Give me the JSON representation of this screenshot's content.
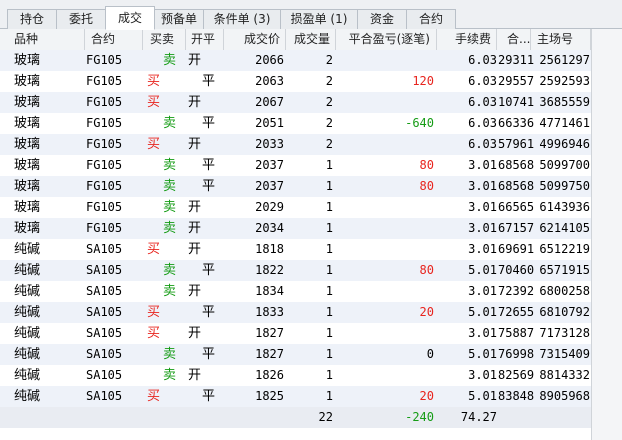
{
  "tabs": [
    {
      "label": "持仓",
      "active": false
    },
    {
      "label": "委托",
      "active": false
    },
    {
      "label": "成交",
      "active": true
    },
    {
      "label": "预备单",
      "active": false
    },
    {
      "label": "条件单 (3)",
      "active": false
    },
    {
      "label": "损盈单 (1)",
      "active": false
    },
    {
      "label": "资金",
      "active": false
    },
    {
      "label": "合约",
      "active": false
    }
  ],
  "columns": [
    "品种",
    "合约",
    "买卖",
    "开平",
    "成交价",
    "成交量",
    "平合盈亏(逐笔)",
    "手续费",
    "合...",
    "主场号"
  ],
  "rows": [
    {
      "product": "玻璃",
      "contract": "FG105",
      "side": "卖",
      "oc": "开",
      "price": "2066",
      "qty": "2",
      "pnl": "",
      "fee": "6.03",
      "trade": "29311",
      "id": "2561297"
    },
    {
      "product": "玻璃",
      "contract": "FG105",
      "side": "买",
      "oc": "平",
      "price": "2063",
      "qty": "2",
      "pnl": "120",
      "fee": "6.03",
      "trade": "29557",
      "id": "2592593"
    },
    {
      "product": "玻璃",
      "contract": "FG105",
      "side": "买",
      "oc": "开",
      "price": "2067",
      "qty": "2",
      "pnl": "",
      "fee": "6.03",
      "trade": "10741",
      "id": "3685559"
    },
    {
      "product": "玻璃",
      "contract": "FG105",
      "side": "卖",
      "oc": "平",
      "price": "2051",
      "qty": "2",
      "pnl": "-640",
      "fee": "6.03",
      "trade": "66336",
      "id": "4771461"
    },
    {
      "product": "玻璃",
      "contract": "FG105",
      "side": "买",
      "oc": "开",
      "price": "2033",
      "qty": "2",
      "pnl": "",
      "fee": "6.03",
      "trade": "57961",
      "id": "4996946"
    },
    {
      "product": "玻璃",
      "contract": "FG105",
      "side": "卖",
      "oc": "平",
      "price": "2037",
      "qty": "1",
      "pnl": "80",
      "fee": "3.01",
      "trade": "68568",
      "id": "5099700"
    },
    {
      "product": "玻璃",
      "contract": "FG105",
      "side": "卖",
      "oc": "平",
      "price": "2037",
      "qty": "1",
      "pnl": "80",
      "fee": "3.01",
      "trade": "68568",
      "id": "5099750"
    },
    {
      "product": "玻璃",
      "contract": "FG105",
      "side": "卖",
      "oc": "开",
      "price": "2029",
      "qty": "1",
      "pnl": "",
      "fee": "3.01",
      "trade": "66565",
      "id": "6143936"
    },
    {
      "product": "玻璃",
      "contract": "FG105",
      "side": "卖",
      "oc": "开",
      "price": "2034",
      "qty": "1",
      "pnl": "",
      "fee": "3.01",
      "trade": "67157",
      "id": "6214105"
    },
    {
      "product": "纯碱",
      "contract": "SA105",
      "side": "买",
      "oc": "开",
      "price": "1818",
      "qty": "1",
      "pnl": "",
      "fee": "3.01",
      "trade": "69691",
      "id": "6512219"
    },
    {
      "product": "纯碱",
      "contract": "SA105",
      "side": "卖",
      "oc": "平",
      "price": "1822",
      "qty": "1",
      "pnl": "80",
      "fee": "5.01",
      "trade": "70460",
      "id": "6571915"
    },
    {
      "product": "纯碱",
      "contract": "SA105",
      "side": "卖",
      "oc": "开",
      "price": "1834",
      "qty": "1",
      "pnl": "",
      "fee": "3.01",
      "trade": "72392",
      "id": "6800258"
    },
    {
      "product": "纯碱",
      "contract": "SA105",
      "side": "买",
      "oc": "平",
      "price": "1833",
      "qty": "1",
      "pnl": "20",
      "fee": "5.01",
      "trade": "72655",
      "id": "6810792"
    },
    {
      "product": "纯碱",
      "contract": "SA105",
      "side": "买",
      "oc": "开",
      "price": "1827",
      "qty": "1",
      "pnl": "",
      "fee": "3.01",
      "trade": "75887",
      "id": "7173128"
    },
    {
      "product": "纯碱",
      "contract": "SA105",
      "side": "卖",
      "oc": "平",
      "price": "1827",
      "qty": "1",
      "pnl": "0",
      "fee": "5.01",
      "trade": "76998",
      "id": "7315409"
    },
    {
      "product": "纯碱",
      "contract": "SA105",
      "side": "卖",
      "oc": "开",
      "price": "1826",
      "qty": "1",
      "pnl": "",
      "fee": "3.01",
      "trade": "82569",
      "id": "8814332"
    },
    {
      "product": "纯碱",
      "contract": "SA105",
      "side": "买",
      "oc": "平",
      "price": "1825",
      "qty": "1",
      "pnl": "20",
      "fee": "5.01",
      "trade": "83848",
      "id": "8905968"
    }
  ],
  "totals": {
    "qty": "22",
    "pnl": "-240",
    "fee": "74.27"
  },
  "colors": {
    "buy": "#e8251f",
    "sell": "#169c16",
    "loss": "#169c16",
    "profit": "#e8251f",
    "alt_row": "#eef2f9"
  }
}
